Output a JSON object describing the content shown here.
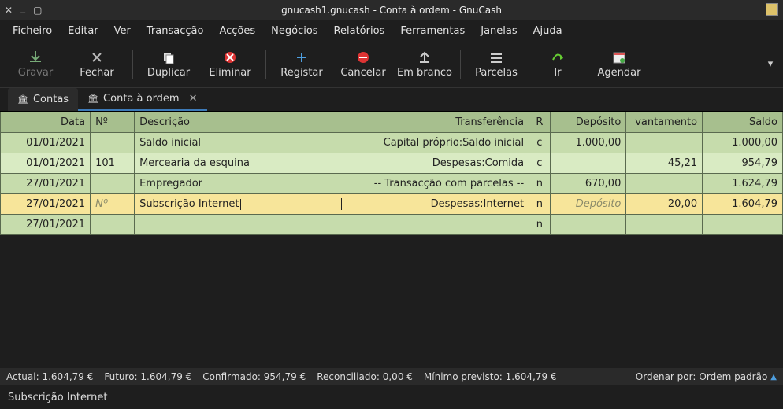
{
  "window": {
    "title": "gnucash1.gnucash - Conta à ordem - GnuCash"
  },
  "menubar": [
    "Ficheiro",
    "Editar",
    "Ver",
    "Transacção",
    "Acções",
    "Negócios",
    "Relatórios",
    "Ferramentas",
    "Janelas",
    "Ajuda"
  ],
  "toolbar": {
    "gravar": "Gravar",
    "fechar": "Fechar",
    "duplicar": "Duplicar",
    "eliminar": "Eliminar",
    "registar": "Registar",
    "cancelar": "Cancelar",
    "embranco": "Em branco",
    "parcelas": "Parcelas",
    "ir": "Ir",
    "agendar": "Agendar"
  },
  "tabs": {
    "contas": "Contas",
    "conta_a_ordem": "Conta à ordem"
  },
  "columns": {
    "data": "Data",
    "num": "Nº",
    "descricao": "Descrição",
    "transferencia": "Transferência",
    "r": "R",
    "deposito": "Depósito",
    "levantamento": "vantamento",
    "saldo": "Saldo"
  },
  "placeholders": {
    "num": "Nº",
    "deposito": "Depósito"
  },
  "rows": [
    {
      "data": "01/01/2021",
      "num": "",
      "desc": "Saldo inicial",
      "transf": "Capital próprio:Saldo inicial",
      "r": "c",
      "dep": "1.000,00",
      "lev": "",
      "saldo": "1.000,00",
      "cls": "row-even"
    },
    {
      "data": "01/01/2021",
      "num": "101",
      "desc": "Mercearia da esquina",
      "transf": "Despesas:Comida",
      "r": "c",
      "dep": "",
      "lev": "45,21",
      "saldo": "954,79",
      "cls": "row-odd"
    },
    {
      "data": "27/01/2021",
      "num": "",
      "desc": "Empregador",
      "transf": "-- Transacção com parcelas --",
      "r": "n",
      "dep": "670,00",
      "lev": "",
      "saldo": "1.624,79",
      "cls": "row-even"
    },
    {
      "data": "27/01/2021",
      "num": "",
      "desc": "Subscrição Internet",
      "transf": "Despesas:Internet",
      "r": "n",
      "dep": "",
      "lev": "20,00",
      "saldo": "1.604,79",
      "cls": "row-sel",
      "selected": true
    },
    {
      "data": "27/01/2021",
      "num": "",
      "desc": "",
      "transf": "",
      "r": "n",
      "dep": "",
      "lev": "",
      "saldo": "",
      "cls": "row-even"
    }
  ],
  "summary": {
    "actual_l": "Actual:",
    "actual_v": "1.604,79 €",
    "futuro_l": "Futuro:",
    "futuro_v": "1.604,79 €",
    "confirmado_l": "Confirmado:",
    "confirmado_v": "954,79 €",
    "reconciliado_l": "Reconciliado:",
    "reconciliado_v": "0,00 €",
    "minimo_l": "Mínimo previsto:",
    "minimo_v": "1.604,79 €",
    "ordenar_l": "Ordenar por:",
    "ordenar_v": "Ordem padrão"
  },
  "status": "Subscrição Internet"
}
